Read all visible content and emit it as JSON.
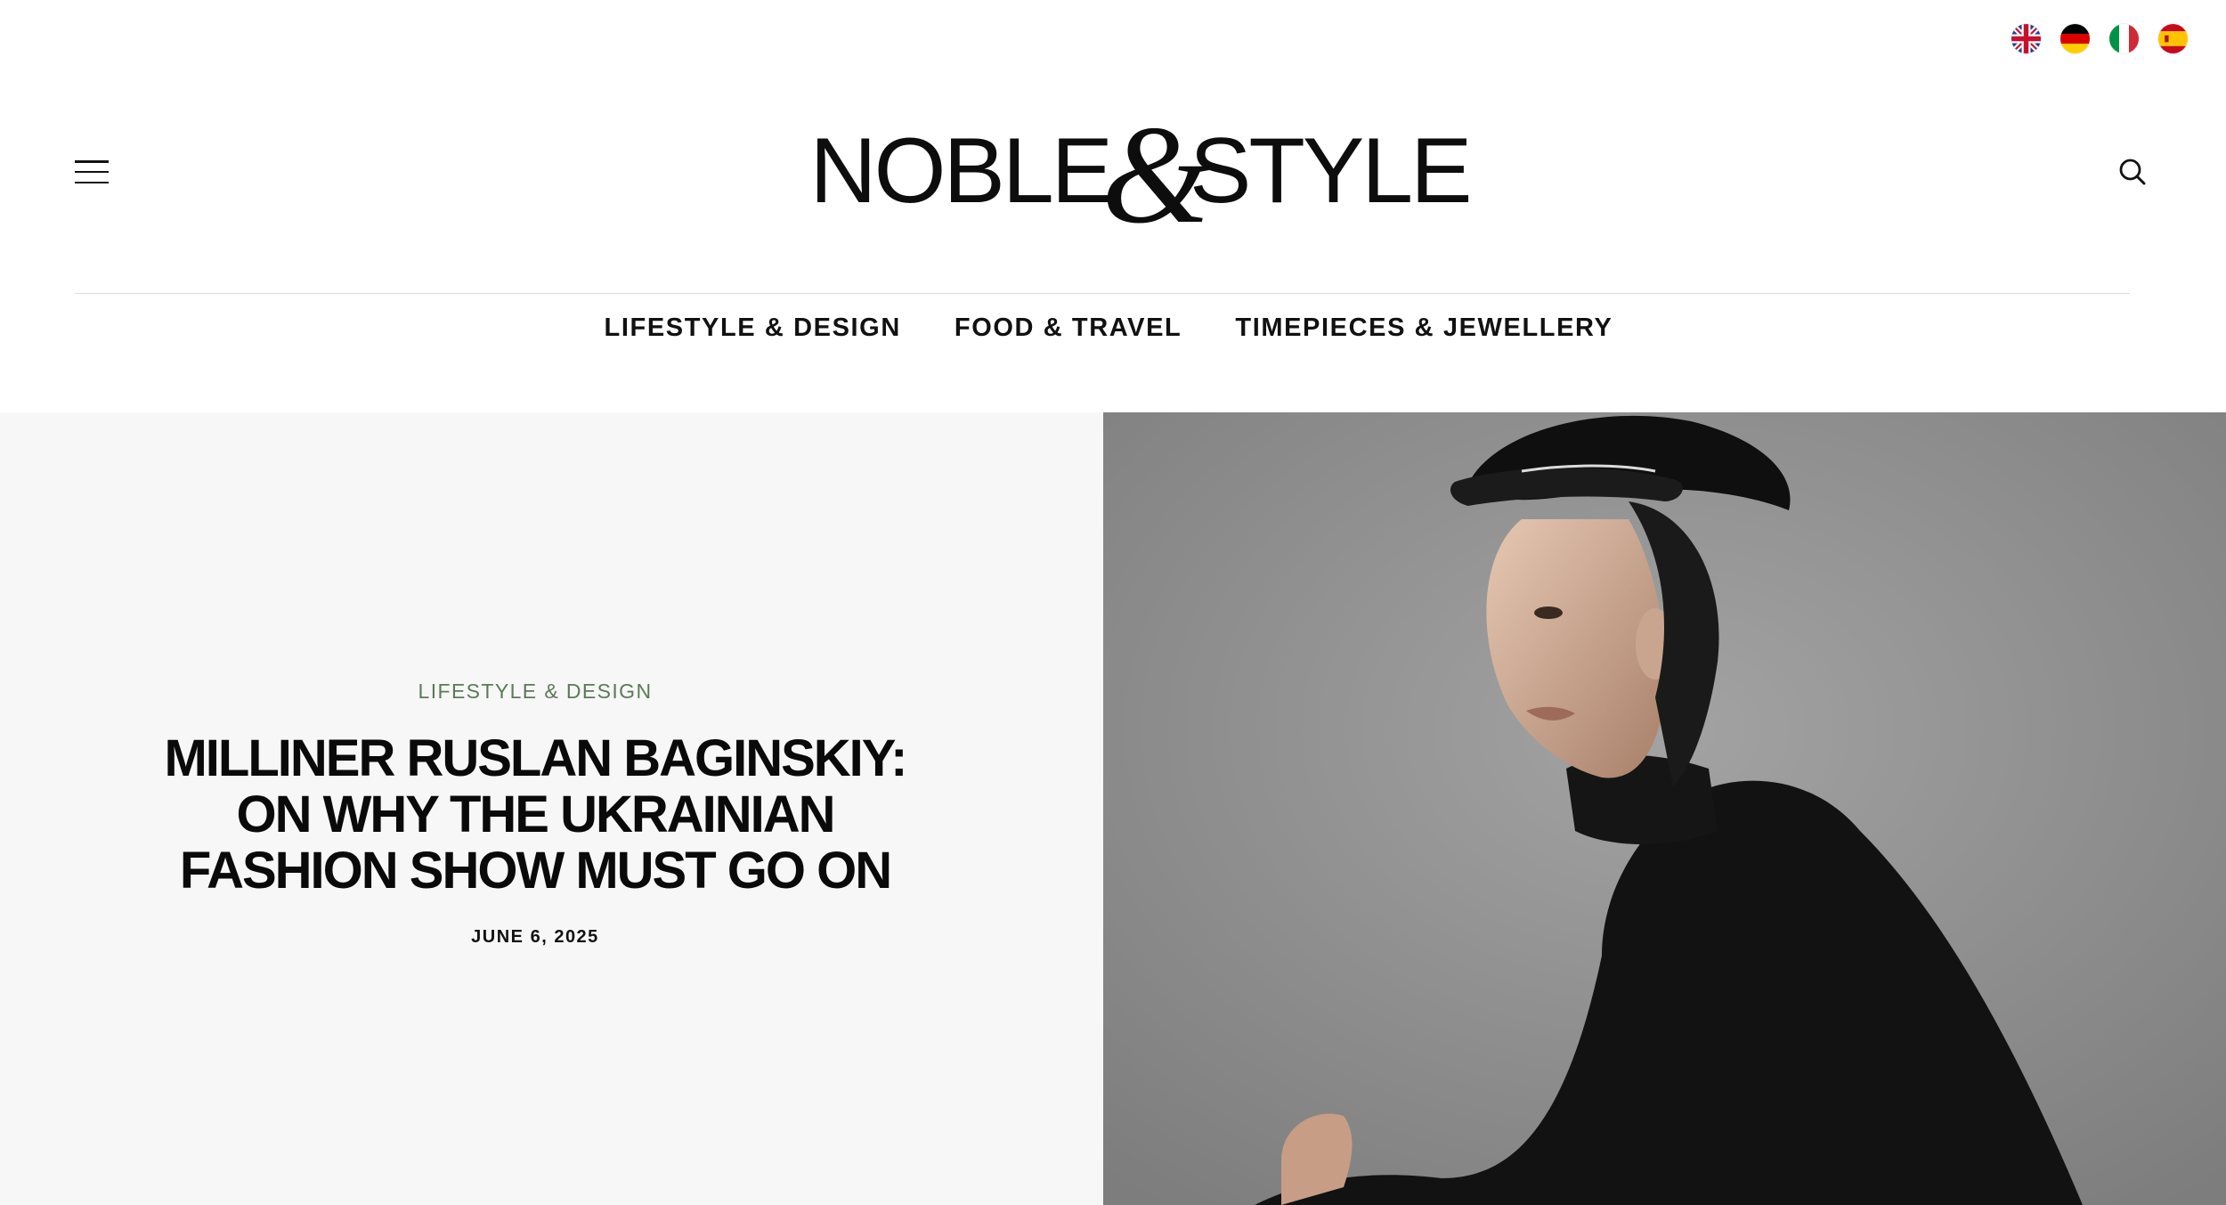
{
  "languages": [
    {
      "code": "en",
      "icon": "uk-flag-icon"
    },
    {
      "code": "de",
      "icon": "germany-flag-icon"
    },
    {
      "code": "it",
      "icon": "italy-flag-icon"
    },
    {
      "code": "es",
      "icon": "spain-flag-icon"
    }
  ],
  "header": {
    "logo": {
      "word1": "NOBLE",
      "amp": "&",
      "word2": "STYLE"
    },
    "menu_icon": "hamburger-menu-icon",
    "search_icon": "search-icon"
  },
  "nav": {
    "items": [
      {
        "label": "LIFESTYLE & DESIGN"
      },
      {
        "label": "FOOD & TRAVEL"
      },
      {
        "label": "TIMEPIECES & JEWELLERY"
      }
    ]
  },
  "hero": {
    "category": "LIFESTYLE & DESIGN",
    "title_lines": [
      "MILLINER RUSLAN BAGINSKIY:",
      "ON WHY THE UKRAINIAN",
      "FASHION SHOW MUST GO ON"
    ],
    "date": "JUNE 6, 2025"
  },
  "colors": {
    "category_green": "#5c7a58",
    "hero_panel_bg": "#f7f7f7",
    "photo_bg": "#8e8e8e"
  }
}
